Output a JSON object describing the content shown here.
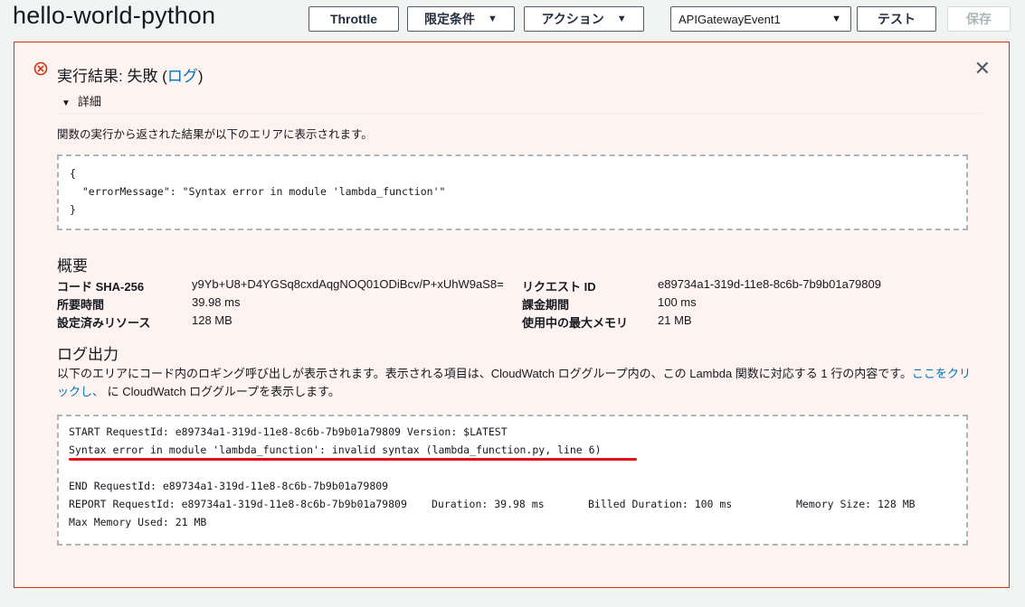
{
  "header": {
    "function_name": "hello-world-python",
    "throttle_label": "Throttle",
    "qualifiers_label": "限定条件",
    "actions_label": "アクション",
    "test_event": "APIGatewayEvent1",
    "test_label": "テスト",
    "save_label": "保存"
  },
  "result": {
    "title_prefix": "実行結果: 失敗 (",
    "log_link": "ログ",
    "title_suffix": ")",
    "details_label": "詳細",
    "description": "関数の実行から返された結果が以下のエリアに表示されます。",
    "output_lines": [
      "{",
      "  \"errorMessage\": \"Syntax error in module 'lambda_function'\"",
      "}"
    ]
  },
  "summary": {
    "heading": "概要",
    "left": [
      {
        "key": "コード SHA-256",
        "value": "y9Yb+U8+D4YGSq8cxdAqgNOQ01ODiBcv/P+xUhW9aS8="
      },
      {
        "key": "所要時間",
        "value": "39.98 ms"
      },
      {
        "key": "設定済みリソース",
        "value": "128 MB"
      }
    ],
    "right": [
      {
        "key": "リクエスト ID",
        "value": "e89734a1-319d-11e8-8c6b-7b9b01a79809"
      },
      {
        "key": "課金期間",
        "value": "100 ms"
      },
      {
        "key": "使用中の最大メモリ",
        "value": "21 MB"
      }
    ]
  },
  "log_output": {
    "heading": "ログ出力",
    "desc_part1": "以下のエリアにコード内のロギング呼び出しが表示されます。表示される項目は、CloudWatch ロググループ内の、この Lambda 関数に対応する 1 行の内容です。",
    "link_text": "ここをクリックし、",
    "desc_part2": " に CloudWatch ロググループを表示します。",
    "lines": [
      "START RequestId: e89734a1-319d-11e8-8c6b-7b9b01a79809 Version: $LATEST",
      "Syntax error in module 'lambda_function': invalid syntax (lambda_function.py, line 6)",
      "",
      "END RequestId: e89734a1-319d-11e8-8c6b-7b9b01a79809"
    ],
    "report": {
      "request": "REPORT RequestId: e89734a1-319d-11e8-8c6b-7b9b01a79809",
      "duration": "Duration: 39.98 ms",
      "billed": "Billed Duration: 100 ms",
      "memory": "Memory Size: 128 MB"
    },
    "max_memory": "Max Memory Used: 21 MB"
  },
  "colors": {
    "error_red": "#d13212",
    "link_blue": "#0073bb",
    "highlight_underline": "#e3101b"
  },
  "icons": [
    "error-circle-icon",
    "close-icon",
    "caret-down-icon",
    "triangle-down-icon"
  ]
}
